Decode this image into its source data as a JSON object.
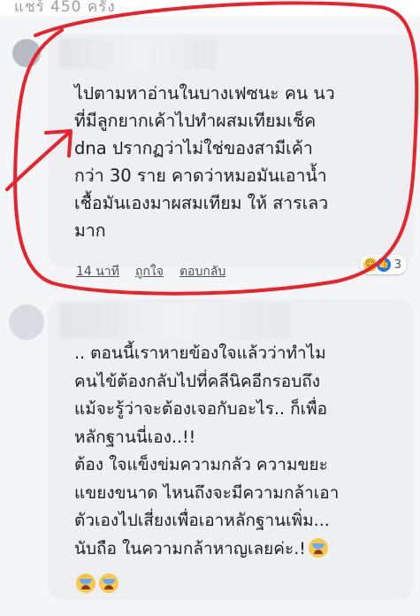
{
  "header": {
    "partial_text": "แชร์ 450 ครั้ง"
  },
  "comments": [
    {
      "text": "ไปตามหาอ่านในบางเฟซนะ คน นว\nที่มีลูกยากเค้าไปทำผสมเทียมเช็ค\ndna ปรากฏว่าไม่ใช่ของสามีเค้า\nกว่า 30 ราย คาดว่าหมอมันเอาน้ำ\nเชื้อมันเองมาผสมเทียม ให้ สารเลว\nมาก",
      "time": "14 นาที",
      "like_label": "ถูกใจ",
      "reply_label": "ตอบกลับ",
      "reaction_count": "3",
      "reaction_icons": [
        "haha-icon",
        "like-icon"
      ]
    },
    {
      "text": ".. ตอนนี้เราหายข้องใจแล้วว่าทำไม\nคนไข้ต้องกลับไปที่คลีนิคอีกรอบถึง\nแม้จะรู้ว่าจะต้องเจอกับอะไร.. ก็เพื่อ\nหลักฐานนี่เอง..!!\nต้อง ใจแข็งข่มความกลัว ความขยะ\nแขยงขนาด ไหนถึงจะมีความกล้าเอา\nตัวเองไปเสี่ยงเพื่อเอาหลักฐานเพิ่ม...\nนับถือ ในความกล้าหาญเลยค่ะ.!",
      "emoji_icons": [
        "crying-face-icon",
        "crying-face-icon",
        "crying-face-icon"
      ]
    }
  ],
  "colors": {
    "annotation_circle": "#e8232c",
    "bubble": "#edeff2",
    "like_blue": "#1877f2"
  }
}
